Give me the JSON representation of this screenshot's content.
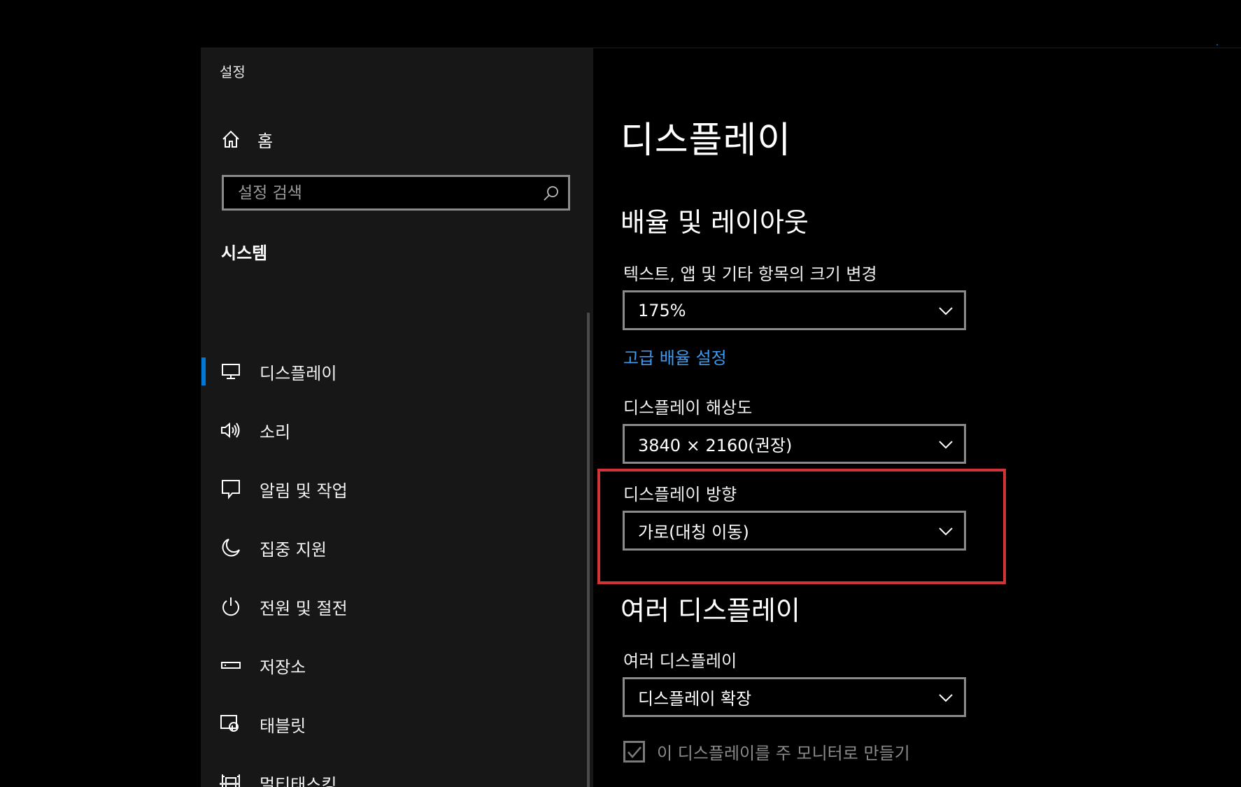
{
  "window": {
    "title": "설정"
  },
  "sidebar": {
    "home_label": "홈",
    "search_placeholder": "설정 검색",
    "section_title": "시스템",
    "items": [
      {
        "label": "디스플레이",
        "icon": "monitor-icon",
        "active": true
      },
      {
        "label": "소리",
        "icon": "speaker-icon"
      },
      {
        "label": "알림 및 작업",
        "icon": "notification-icon"
      },
      {
        "label": "집중 지원",
        "icon": "moon-icon"
      },
      {
        "label": "전원 및 절전",
        "icon": "power-icon"
      },
      {
        "label": "저장소",
        "icon": "storage-icon"
      },
      {
        "label": "태블릿",
        "icon": "tablet-icon"
      },
      {
        "label": "멀티태스킹",
        "icon": "multitasking-icon"
      }
    ]
  },
  "main": {
    "page_title": "디스플레이",
    "scale_section": {
      "heading": "배율 및 레이아웃",
      "scale_label": "텍스트, 앱 및 기타 항목의 크기 변경",
      "scale_value": "175%",
      "advanced_link": "고급 배율 설정",
      "resolution_label": "디스플레이 해상도",
      "resolution_value": "3840 × 2160(권장)",
      "orientation_label": "디스플레이 방향",
      "orientation_value": "가로(대칭 이동)"
    },
    "multi_section": {
      "heading": "여러 디스플레이",
      "multi_label": "여러 디스플레이",
      "multi_value": "디스플레이 확장",
      "main_monitor_checkbox": "이 디스플레이를 주 모니터로 만들기",
      "main_monitor_checked": true
    }
  },
  "colors": {
    "accent": "#0078d7",
    "link": "#3c9af0",
    "highlight": "#d13438",
    "sidebar_bg": "#171717"
  }
}
